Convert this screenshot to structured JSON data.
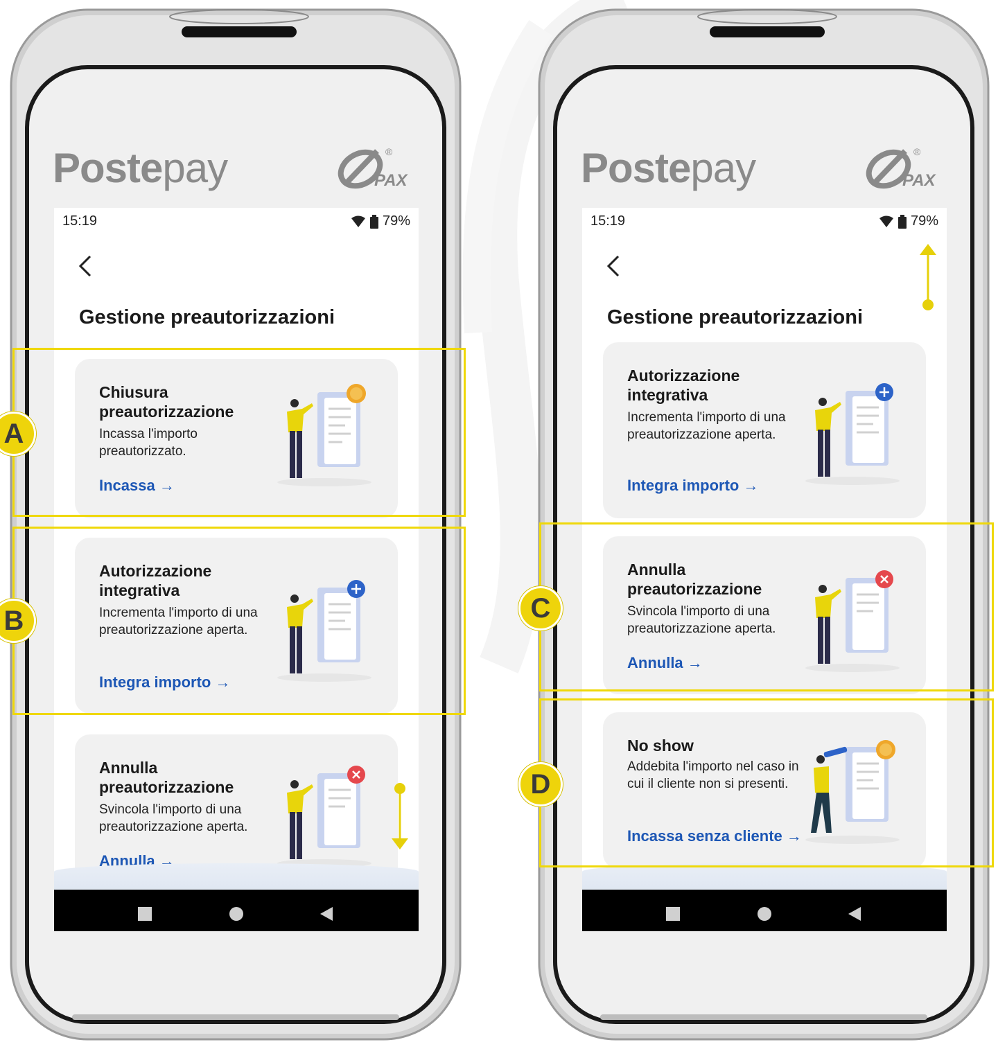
{
  "brand": {
    "name_bold": "Poste",
    "name_light": "pay",
    "partner": "PAX"
  },
  "colors": {
    "accent_yellow": "#EFD80A",
    "link_blue": "#1D57B5",
    "card_bg": "#F1F1F1",
    "plus_blue": "#2D63C8",
    "cancel_red": "#E5484D",
    "coin_orange": "#EFA72A"
  },
  "left_screen": {
    "status": {
      "time": "15:19",
      "battery": "79%"
    },
    "title": "Gestione preautorizzazioni",
    "cards": [
      {
        "title": "Chiusura preautorizzazione",
        "description": "Incassa l'importo preautorizzato.",
        "link": "Incassa →",
        "badge_icon": "coin-icon"
      },
      {
        "title": "Autorizzazione integrativa",
        "description": "Incrementa l'importo di una preautorizzazione aperta.",
        "link": "Integra importo →",
        "badge_icon": "plus-icon"
      },
      {
        "title": "Annulla preautorizzazione",
        "description": "Svincola l'importo di una preautorizzazione aperta.",
        "link": "Annulla →",
        "badge_icon": "close-icon"
      }
    ],
    "callouts": [
      "A",
      "B"
    ],
    "scroll_hint": "down"
  },
  "right_screen": {
    "status": {
      "time": "15:19",
      "battery": "79%"
    },
    "title": "Gestione preautorizzazioni",
    "cards": [
      {
        "title": "Autorizzazione integrativa",
        "description": "Incrementa l'importo di una preautorizzazione aperta.",
        "link": "Integra importo →",
        "badge_icon": "plus-icon"
      },
      {
        "title": "Annulla preautorizzazione",
        "description": "Svincola l'importo di una preautorizzazione aperta.",
        "link": "Annulla →",
        "badge_icon": "close-icon"
      },
      {
        "title": "No show",
        "description": "Addebita l'importo nel caso in cui il cliente non si presenti.",
        "link": "Incassa senza cliente →",
        "badge_icon": "coin-icon"
      }
    ],
    "callouts": [
      "C",
      "D"
    ],
    "scroll_hint": "up"
  }
}
